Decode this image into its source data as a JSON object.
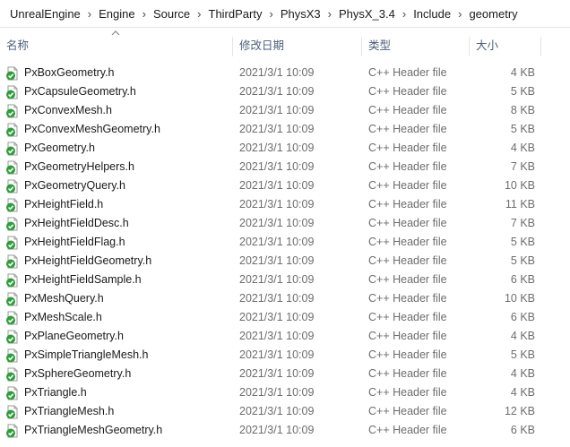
{
  "breadcrumb": [
    "UnrealEngine",
    "Engine",
    "Source",
    "ThirdParty",
    "PhysX3",
    "PhysX_3.4",
    "Include",
    "geometry"
  ],
  "columns": {
    "name": "名称",
    "date": "修改日期",
    "type": "类型",
    "size": "大小"
  },
  "files": [
    {
      "name": "PxBoxGeometry.h",
      "date": "2021/3/1 10:09",
      "type": "C++ Header file",
      "size": "4 KB"
    },
    {
      "name": "PxCapsuleGeometry.h",
      "date": "2021/3/1 10:09",
      "type": "C++ Header file",
      "size": "5 KB"
    },
    {
      "name": "PxConvexMesh.h",
      "date": "2021/3/1 10:09",
      "type": "C++ Header file",
      "size": "8 KB"
    },
    {
      "name": "PxConvexMeshGeometry.h",
      "date": "2021/3/1 10:09",
      "type": "C++ Header file",
      "size": "5 KB"
    },
    {
      "name": "PxGeometry.h",
      "date": "2021/3/1 10:09",
      "type": "C++ Header file",
      "size": "4 KB"
    },
    {
      "name": "PxGeometryHelpers.h",
      "date": "2021/3/1 10:09",
      "type": "C++ Header file",
      "size": "7 KB"
    },
    {
      "name": "PxGeometryQuery.h",
      "date": "2021/3/1 10:09",
      "type": "C++ Header file",
      "size": "10 KB"
    },
    {
      "name": "PxHeightField.h",
      "date": "2021/3/1 10:09",
      "type": "C++ Header file",
      "size": "11 KB"
    },
    {
      "name": "PxHeightFieldDesc.h",
      "date": "2021/3/1 10:09",
      "type": "C++ Header file",
      "size": "7 KB"
    },
    {
      "name": "PxHeightFieldFlag.h",
      "date": "2021/3/1 10:09",
      "type": "C++ Header file",
      "size": "5 KB"
    },
    {
      "name": "PxHeightFieldGeometry.h",
      "date": "2021/3/1 10:09",
      "type": "C++ Header file",
      "size": "5 KB"
    },
    {
      "name": "PxHeightFieldSample.h",
      "date": "2021/3/1 10:09",
      "type": "C++ Header file",
      "size": "6 KB"
    },
    {
      "name": "PxMeshQuery.h",
      "date": "2021/3/1 10:09",
      "type": "C++ Header file",
      "size": "10 KB"
    },
    {
      "name": "PxMeshScale.h",
      "date": "2021/3/1 10:09",
      "type": "C++ Header file",
      "size": "6 KB"
    },
    {
      "name": "PxPlaneGeometry.h",
      "date": "2021/3/1 10:09",
      "type": "C++ Header file",
      "size": "4 KB"
    },
    {
      "name": "PxSimpleTriangleMesh.h",
      "date": "2021/3/1 10:09",
      "type": "C++ Header file",
      "size": "5 KB"
    },
    {
      "name": "PxSphereGeometry.h",
      "date": "2021/3/1 10:09",
      "type": "C++ Header file",
      "size": "4 KB"
    },
    {
      "name": "PxTriangle.h",
      "date": "2021/3/1 10:09",
      "type": "C++ Header file",
      "size": "4 KB"
    },
    {
      "name": "PxTriangleMesh.h",
      "date": "2021/3/1 10:09",
      "type": "C++ Header file",
      "size": "12 KB"
    },
    {
      "name": "PxTriangleMeshGeometry.h",
      "date": "2021/3/1 10:09",
      "type": "C++ Header file",
      "size": "6 KB"
    }
  ],
  "icons": {
    "file": "header-file-sync-ok-icon",
    "separator": "chevron-right-icon",
    "sort": "sort-ascending-icon"
  },
  "colors": {
    "header_text": "#4c607a",
    "sync_badge": "#2e9e3b",
    "secondary_text": "#6d6d6d"
  }
}
